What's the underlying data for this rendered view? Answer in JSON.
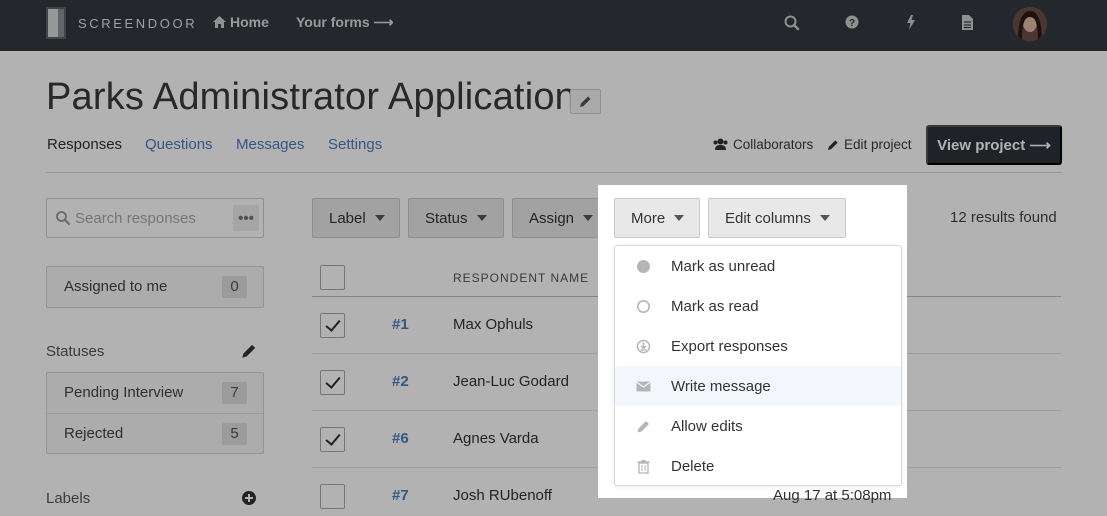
{
  "nav": {
    "brand": "SCREENDOOR",
    "home": "Home",
    "your_forms": "Your forms ⟶",
    "icons": [
      "search-icon",
      "help-icon",
      "bolt-icon",
      "document-icon"
    ]
  },
  "header": {
    "title": "Parks Administrator Application",
    "tabs": [
      "Responses",
      "Questions",
      "Messages",
      "Settings"
    ],
    "collaborators": "Collaborators",
    "edit_project": "Edit project",
    "view_project": "View project ⟶"
  },
  "sidebar": {
    "search_placeholder": "Search responses",
    "search_more": "•••",
    "assigned": {
      "label": "Assigned to me",
      "count": "0"
    },
    "statuses_heading": "Statuses",
    "statuses": [
      {
        "label": "Pending Interview",
        "count": "7"
      },
      {
        "label": "Rejected",
        "count": "5"
      }
    ],
    "labels_heading": "Labels"
  },
  "toolbar": {
    "label": "Label",
    "status": "Status",
    "assign": "Assign",
    "more": "More",
    "edit_columns": "Edit columns",
    "results": "12 results found"
  },
  "table": {
    "column_name": "RESPONDENT NAME",
    "rows": [
      {
        "id": "#1",
        "name": "Max Ophuls",
        "checked": true,
        "date": ""
      },
      {
        "id": "#2",
        "name": "Jean-Luc Godard",
        "checked": true,
        "date": ""
      },
      {
        "id": "#6",
        "name": "Agnes Varda",
        "checked": true,
        "date": ""
      },
      {
        "id": "#7",
        "name": "Josh RUbenoff",
        "checked": false,
        "date": "Aug 17 at 5:08pm"
      }
    ]
  },
  "more_menu": {
    "items": [
      {
        "label": "Mark as unread",
        "icon": "filled-circle-icon"
      },
      {
        "label": "Mark as read",
        "icon": "empty-circle-icon"
      },
      {
        "label": "Export responses",
        "icon": "download-icon"
      },
      {
        "label": "Write message",
        "icon": "envelope-icon"
      },
      {
        "label": "Allow edits",
        "icon": "pencil-icon"
      },
      {
        "label": "Delete",
        "icon": "trash-icon"
      }
    ],
    "hovered": "Write message"
  },
  "colors": {
    "nav_bg": "#343a40",
    "link": "#4d7bbd",
    "primary_button": "#2d3238",
    "menu_hover": "#f3f6fa"
  }
}
